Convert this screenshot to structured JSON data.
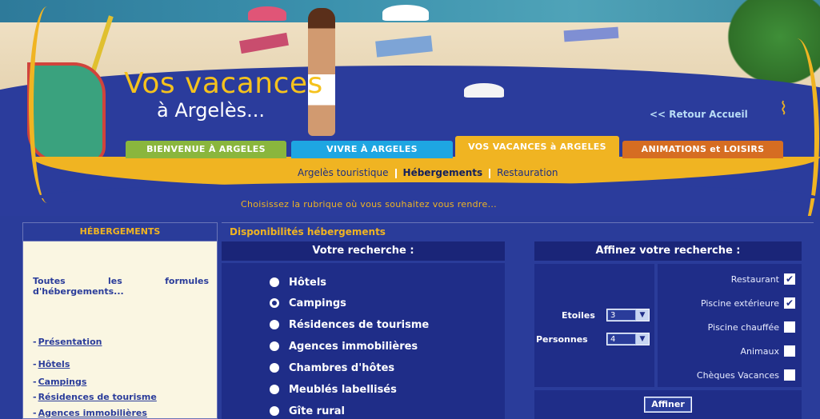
{
  "header": {
    "logo_title": "Vos vacances",
    "logo_sub": "à Argelès...",
    "retour": "<< Retour Accueil",
    "tabs": [
      {
        "label": "BIENVENUE À ARGELES"
      },
      {
        "label": "VIVRE À ARGELES"
      },
      {
        "label": "VOS VACANCES à ARGELES"
      },
      {
        "label": "ANIMATIONS et LOISIRS"
      }
    ],
    "subnav": [
      "Argelès touristique",
      "Hébergements",
      "Restauration"
    ],
    "choose_text": "Choisissez la rubrique où vous souhaitez vous rendre...",
    "accent_yellow": "#f0b422",
    "bg_blue": "#2a3c9a"
  },
  "sidebar": {
    "title": "HÉBERGEMENTS",
    "intro": "Toutes les formules d'hébergements...",
    "links": [
      "Présentation",
      "Hôtels",
      "Campings",
      "Résidences de tourisme",
      "Agences immobilières"
    ]
  },
  "main": {
    "title": "Disponibilités hébergements",
    "search": {
      "title": "Votre recherche :",
      "options": [
        "Hôtels",
        "Campings",
        "Résidences de tourisme",
        "Agences immobilières",
        "Chambres d'hôtes",
        "Meublés labellisés",
        "Gîte rural"
      ],
      "selected": "Campings"
    },
    "refine": {
      "title": "Affinez votre recherche :",
      "etoiles_label": "Etoiles",
      "etoiles_value": "3",
      "personnes_label": "Personnes",
      "personnes_value": "4",
      "checks": [
        {
          "label": "Restaurant",
          "checked": true,
          "mark": "✔"
        },
        {
          "label": "Piscine extérieure",
          "checked": true,
          "mark": "✔"
        },
        {
          "label": "Piscine chauffée",
          "checked": false,
          "mark": ""
        },
        {
          "label": "Animaux",
          "checked": false,
          "mark": ""
        },
        {
          "label": "Chèques Vacances",
          "checked": false,
          "mark": ""
        }
      ],
      "button": "Affiner"
    }
  }
}
